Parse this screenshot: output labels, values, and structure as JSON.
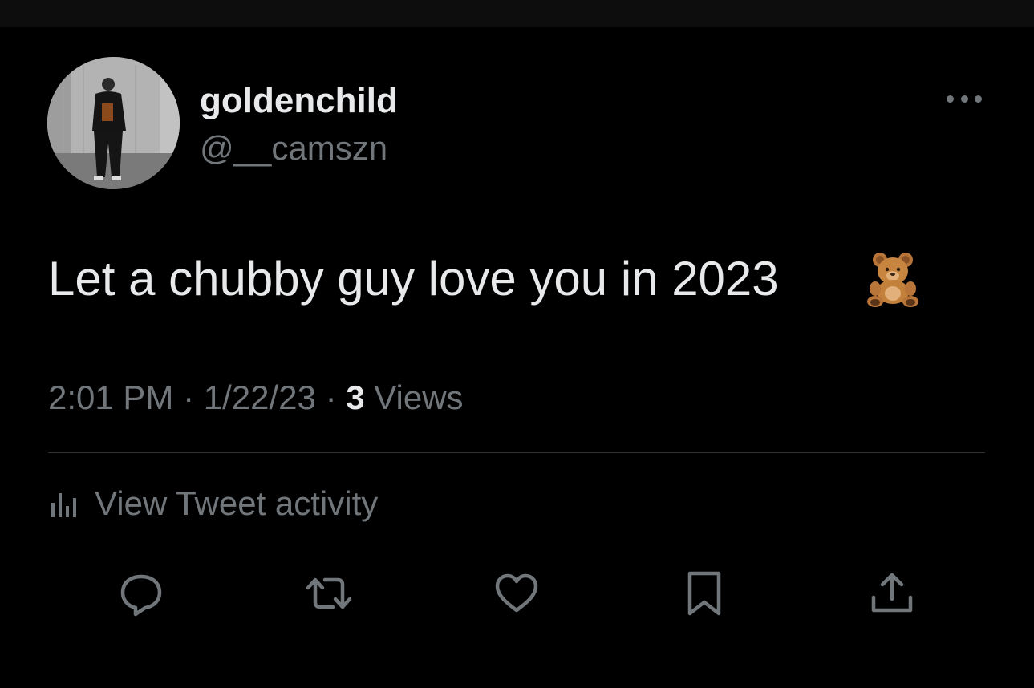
{
  "author": {
    "display_name": "goldenchild",
    "handle": "@__camszn"
  },
  "tweet": {
    "text": "Let a chubby guy love you in 2023",
    "emoji": "teddy-bear-emoji"
  },
  "meta": {
    "time": "2:01 PM",
    "separator": "·",
    "date": "1/22/23",
    "views_count": "3",
    "views_label": "Views"
  },
  "activity": {
    "label": "View Tweet activity",
    "icon": "analytics-icon"
  },
  "actions": [
    {
      "icon": "reply-icon"
    },
    {
      "icon": "retweet-icon"
    },
    {
      "icon": "like-icon"
    },
    {
      "icon": "bookmark-icon"
    },
    {
      "icon": "share-icon"
    }
  ],
  "colors": {
    "background": "#000000",
    "primary_text": "#e7e9ea",
    "secondary_text": "#71767b",
    "divider": "#2f3336"
  }
}
